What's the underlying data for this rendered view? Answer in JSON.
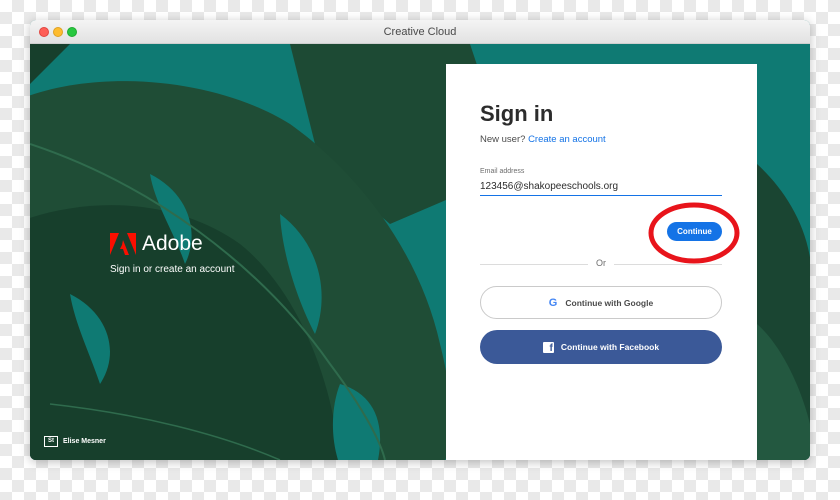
{
  "window": {
    "title": "Creative Cloud"
  },
  "brand": {
    "name": "Adobe",
    "subtitle": "Sign in or create an account"
  },
  "credit": {
    "badge": "St",
    "name": "Elise Mesner"
  },
  "signin": {
    "title": "Sign in",
    "new_user_prompt": "New user?",
    "create_account_link": "Create an account",
    "email_label": "Email address",
    "email_value": "123456@shakopeeschools.org",
    "continue_label": "Continue",
    "or_text": "Or",
    "google_icon": "G",
    "google_label": "Continue with Google",
    "facebook_icon": "f",
    "facebook_label": "Continue with Facebook"
  },
  "colors": {
    "background_teal": "#0f7a73",
    "leaf_dark": "#1d4a34",
    "accent_blue": "#1473e6",
    "facebook_blue": "#3b5998",
    "adobe_red": "#fa0f00",
    "annotation_red": "#e8141b"
  },
  "icons": {
    "logo": "adobe-logo-icon",
    "google": "google-icon",
    "facebook": "facebook-icon",
    "stock": "adobe-stock-icon"
  }
}
